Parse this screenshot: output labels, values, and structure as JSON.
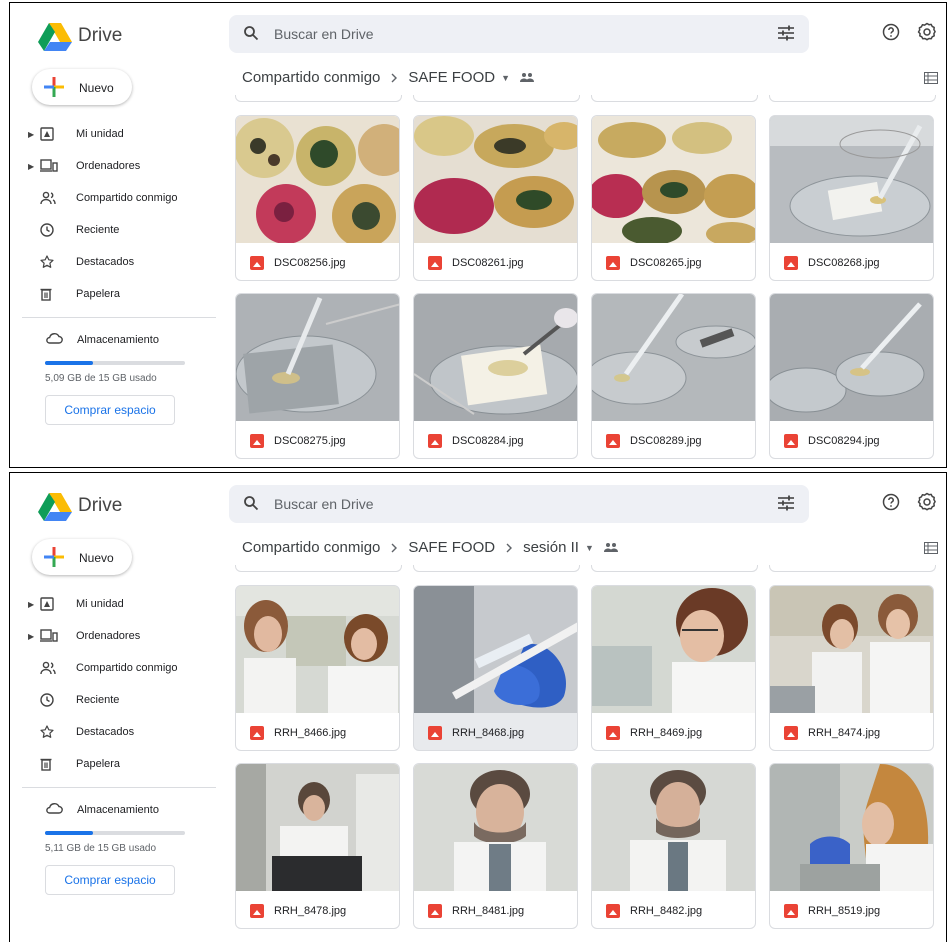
{
  "panels": [
    {
      "app_name": "Drive",
      "search_placeholder": "Buscar en Drive",
      "new_button": "Nuevo",
      "nav": [
        "Mi unidad",
        "Ordenadores",
        "Compartido conmigo",
        "Reciente",
        "Destacados",
        "Papelera"
      ],
      "storage_label": "Almacenamiento",
      "storage_used_text": "5,09 GB de 15 GB usado",
      "storage_fraction": 0.34,
      "buy_button": "Comprar espacio",
      "breadcrumb": [
        "Compartido conmigo",
        "SAFE FOOD"
      ],
      "files": [
        "DSC08256.jpg",
        "DSC08261.jpg",
        "DSC08265.jpg",
        "DSC08268.jpg",
        "DSC08275.jpg",
        "DSC08284.jpg",
        "DSC08289.jpg",
        "DSC08294.jpg"
      ]
    },
    {
      "app_name": "Drive",
      "search_placeholder": "Buscar en Drive",
      "new_button": "Nuevo",
      "nav": [
        "Mi unidad",
        "Ordenadores",
        "Compartido conmigo",
        "Reciente",
        "Destacados",
        "Papelera"
      ],
      "storage_label": "Almacenamiento",
      "storage_used_text": "5,11 GB de 15 GB usado",
      "storage_fraction": 0.34,
      "buy_button": "Comprar espacio",
      "breadcrumb": [
        "Compartido conmigo",
        "SAFE FOOD",
        "sesión II"
      ],
      "files": [
        "RRH_8466.jpg",
        "RRH_8468.jpg",
        "RRH_8469.jpg",
        "RRH_8474.jpg",
        "RRH_8478.jpg",
        "RRH_8481.jpg",
        "RRH_8482.jpg",
        "RRH_8519.jpg"
      ],
      "selected_file": "RRH_8468.jpg"
    }
  ],
  "colors": {
    "accent": "#1a73e8",
    "file_icon": "#ea4335",
    "search_bg": "#eef0f5"
  },
  "icons": {
    "nav": [
      "my-drive-icon",
      "computers-icon",
      "shared-icon",
      "recent-icon",
      "star-icon",
      "trash-icon"
    ],
    "header": [
      "search-icon",
      "tune-icon",
      "help-icon",
      "settings-icon"
    ],
    "file": "image-file-icon"
  }
}
